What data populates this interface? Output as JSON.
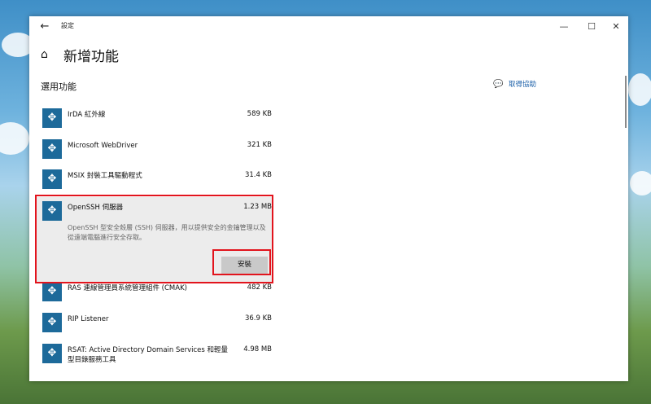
{
  "window": {
    "title": "設定",
    "back_icon": "←",
    "minimize_icon": "—",
    "maximize_icon": "☐",
    "close_icon": "✕"
  },
  "header": {
    "home_icon": "⌂",
    "title": "新增功能"
  },
  "section": {
    "title": "選用功能"
  },
  "help": {
    "icon": "💬",
    "label": "取得協助"
  },
  "features": [
    {
      "name": "IrDA 紅外線",
      "size": "589 KB"
    },
    {
      "name": "Microsoft WebDriver",
      "size": "321 KB"
    },
    {
      "name": "MSIX 封裝工具驅動程式",
      "size": "31.4 KB"
    },
    {
      "name": "OpenSSH 伺服器",
      "size": "1.23 MB",
      "description": "OpenSSH 型安全殼層 (SSH) 伺服器，用以提供安全的金鑰管理以及從遠端電腦進行安全存取。",
      "expanded": true,
      "button": "安裝"
    },
    {
      "name": "RAS 連線管理員系統管理組件 (CMAK)",
      "size": "482 KB"
    },
    {
      "name": "RIP Listener",
      "size": "36.9 KB"
    },
    {
      "name": "RSAT: Active Directory Domain Services 和輕量型目錄服務工具",
      "size": "4.98 MB"
    }
  ],
  "colors": {
    "feature_icon_bg": "#1d6a9a",
    "highlight": "#e2141d",
    "link": "#1a5fa8"
  }
}
